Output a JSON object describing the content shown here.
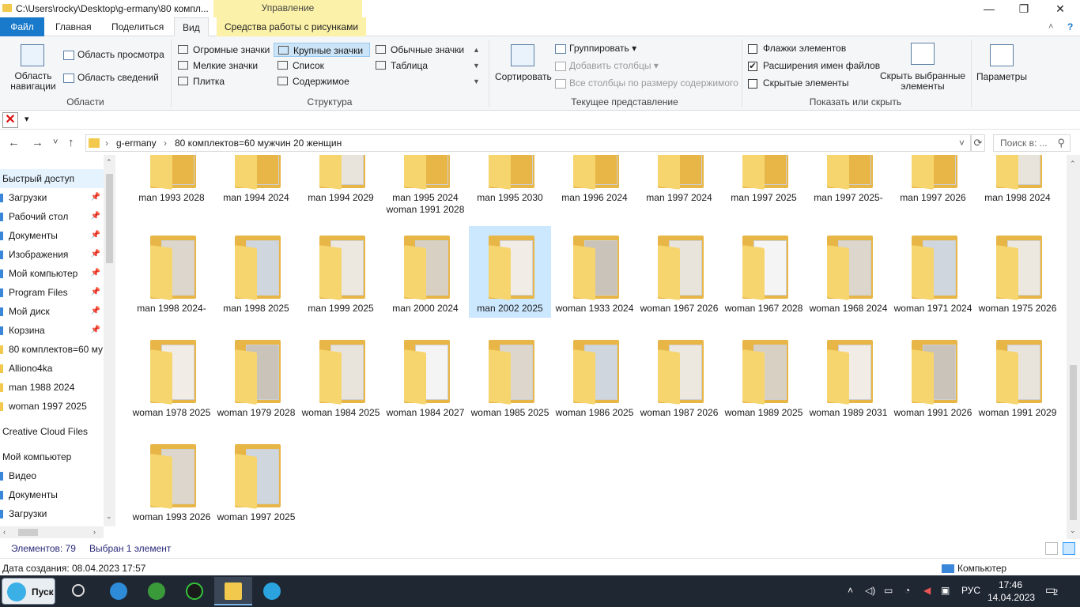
{
  "window": {
    "title": "C:\\Users\\rocky\\Desktop\\g-ermany\\80 компл...",
    "context_group": "Управление",
    "controls": {
      "minimize": "—",
      "maximize": "❐",
      "close": "✕",
      "help": "?",
      "collapse": "˄"
    }
  },
  "ribbon_tabs": {
    "file": "Файл",
    "home": "Главная",
    "share": "Поделиться",
    "view": "Вид",
    "picture_tools": "Средства работы с рисунками"
  },
  "ribbon": {
    "panes": {
      "label": "Области",
      "nav_pane": "Область навигации",
      "preview": "Область просмотра",
      "details": "Область сведений"
    },
    "layout": {
      "label": "Структура",
      "items": [
        "Огромные значки",
        "Крупные значки",
        "Обычные значки",
        "Мелкие значки",
        "Список",
        "Таблица",
        "Плитка",
        "Содержимое"
      ],
      "selected": "Крупные значки"
    },
    "current_view": {
      "label": "Текущее представление",
      "sort": "Сортировать",
      "group": "Группировать",
      "add_columns": "Добавить столбцы",
      "fit_columns": "Все столбцы по размеру содержимого"
    },
    "show_hide": {
      "label": "Показать или скрыть",
      "checkboxes": "Флажки элементов",
      "extensions": "Расширения имен файлов",
      "hidden": "Скрытые элементы",
      "checked": [
        false,
        true,
        false
      ],
      "hide_selected": "Скрыть выбранные элементы"
    },
    "options": "Параметры"
  },
  "qat": {
    "dropdown": "▾"
  },
  "address": {
    "crumbs": [
      "g-ermany",
      "80 комплектов=60 мужчин 20 женщин"
    ],
    "search_placeholder": "Поиск в: ...",
    "back": "←",
    "forward": "→",
    "recent": "˅",
    "up": "↑",
    "refresh": "⟳"
  },
  "nav": {
    "quick_access": "Быстрый доступ",
    "items": [
      {
        "label": "Загрузки",
        "pinned": true
      },
      {
        "label": "Рабочий стол",
        "pinned": true
      },
      {
        "label": "Документы",
        "pinned": true
      },
      {
        "label": "Изображения",
        "pinned": true
      },
      {
        "label": "Мой компьютер",
        "pinned": true
      },
      {
        "label": "Program Files",
        "pinned": true
      },
      {
        "label": "Мой диск",
        "pinned": true
      },
      {
        "label": "Корзина",
        "pinned": true
      },
      {
        "label": "80 комплектов=60 му",
        "pinned": false
      },
      {
        "label": "Alliono4ka",
        "pinned": false
      },
      {
        "label": "man 1988 2024",
        "pinned": false
      },
      {
        "label": "woman 1997 2025",
        "pinned": false
      }
    ],
    "creative_cloud": "Creative Cloud Files",
    "my_computer": "Мой компьютер",
    "pc_items": [
      "Видео",
      "Документы",
      "Загрузки"
    ]
  },
  "folders": {
    "row1": [
      "man 1993 2028",
      "man 1994 2024",
      "man 1994 2029",
      "man 1995 2024 woman 1991 2028",
      "man 1995 2030",
      "man 1996 2024",
      "man 1997 2024",
      "man 1997 2025",
      "man 1997 2025-",
      "man 1997 2026",
      "man 1998 2024"
    ],
    "row2": [
      "man 1998 2024-",
      "man 1998 2025",
      "man 1999 2025",
      "man 2000 2024",
      "man 2002 2025",
      "woman 1933 2024",
      "woman 1967 2026",
      "woman 1967 2028",
      "woman 1968 2024",
      "woman 1971 2024",
      "woman 1975 2026"
    ],
    "row3": [
      "woman 1978 2025",
      "woman 1979 2028",
      "woman 1984 2025",
      "woman 1984 2027",
      "woman 1985 2025",
      "woman 1986 2025",
      "woman 1987 2026",
      "woman 1989 2025",
      "woman 1989 2031",
      "woman 1991 2026",
      "woman 1991 2029"
    ],
    "row4": [
      "woman 1993 2026",
      "woman 1997 2025"
    ],
    "selected": "man 2002 2025"
  },
  "status": {
    "count": "Элементов: 79",
    "selection": "Выбран 1 элемент"
  },
  "details": {
    "created": "Дата создания: 08.04.2023 17:57",
    "location": "Компьютер"
  },
  "taskbar": {
    "start": "Пуск",
    "lang": "РУС",
    "time": "17:46",
    "date": "14.04.2023",
    "notifications": "2",
    "apps": [
      "search",
      "browser",
      "utorrent",
      "cheat-engine",
      "file-explorer",
      "telegram"
    ]
  }
}
